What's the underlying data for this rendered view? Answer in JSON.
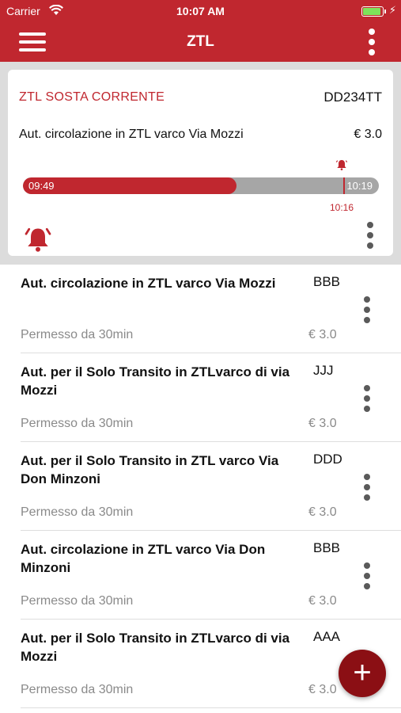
{
  "status_bar": {
    "carrier": "Carrier",
    "time": "10:07 AM",
    "battery_color": "#7ee35a"
  },
  "nav": {
    "title": "ZTL",
    "accent": "#c0272f"
  },
  "current": {
    "title": "ZTL SOSTA CORRENTE",
    "plate": "DD234TT",
    "description": "Aut.  circolazione in ZTL varco Via Mozzi",
    "price": "€ 3.0",
    "start_time": "09:49",
    "end_time": "10:19",
    "alarm_time": "10:16",
    "progress_fraction": 0.6,
    "alarm_fraction": 0.9
  },
  "permits": [
    {
      "title": "Aut.  circolazione in ZTL varco Via Mozzi",
      "plate": "BBB",
      "subtitle": "Permesso da 30min",
      "price": "€ 3.0"
    },
    {
      "title": "Aut. per il  Solo Transito in ZTLvarco di via Mozzi",
      "plate": "JJJ",
      "subtitle": "Permesso da 30min",
      "price": "€ 3.0"
    },
    {
      "title": "Aut. per il Solo Transito in ZTL varco Via Don Minzoni",
      "plate": "DDD",
      "subtitle": "Permesso da 30min",
      "price": "€ 3.0"
    },
    {
      "title": "Aut. circolazione in ZTL varco Via Don Minzoni",
      "plate": "BBB",
      "subtitle": "Permesso da 30min",
      "price": "€ 3.0"
    },
    {
      "title": "Aut. per il  Solo Transito in ZTLvarco di via Mozzi",
      "plate": "AAA",
      "subtitle": "Permesso da 30min",
      "price": "€ 3.0"
    }
  ],
  "fab": {
    "label": "+"
  }
}
